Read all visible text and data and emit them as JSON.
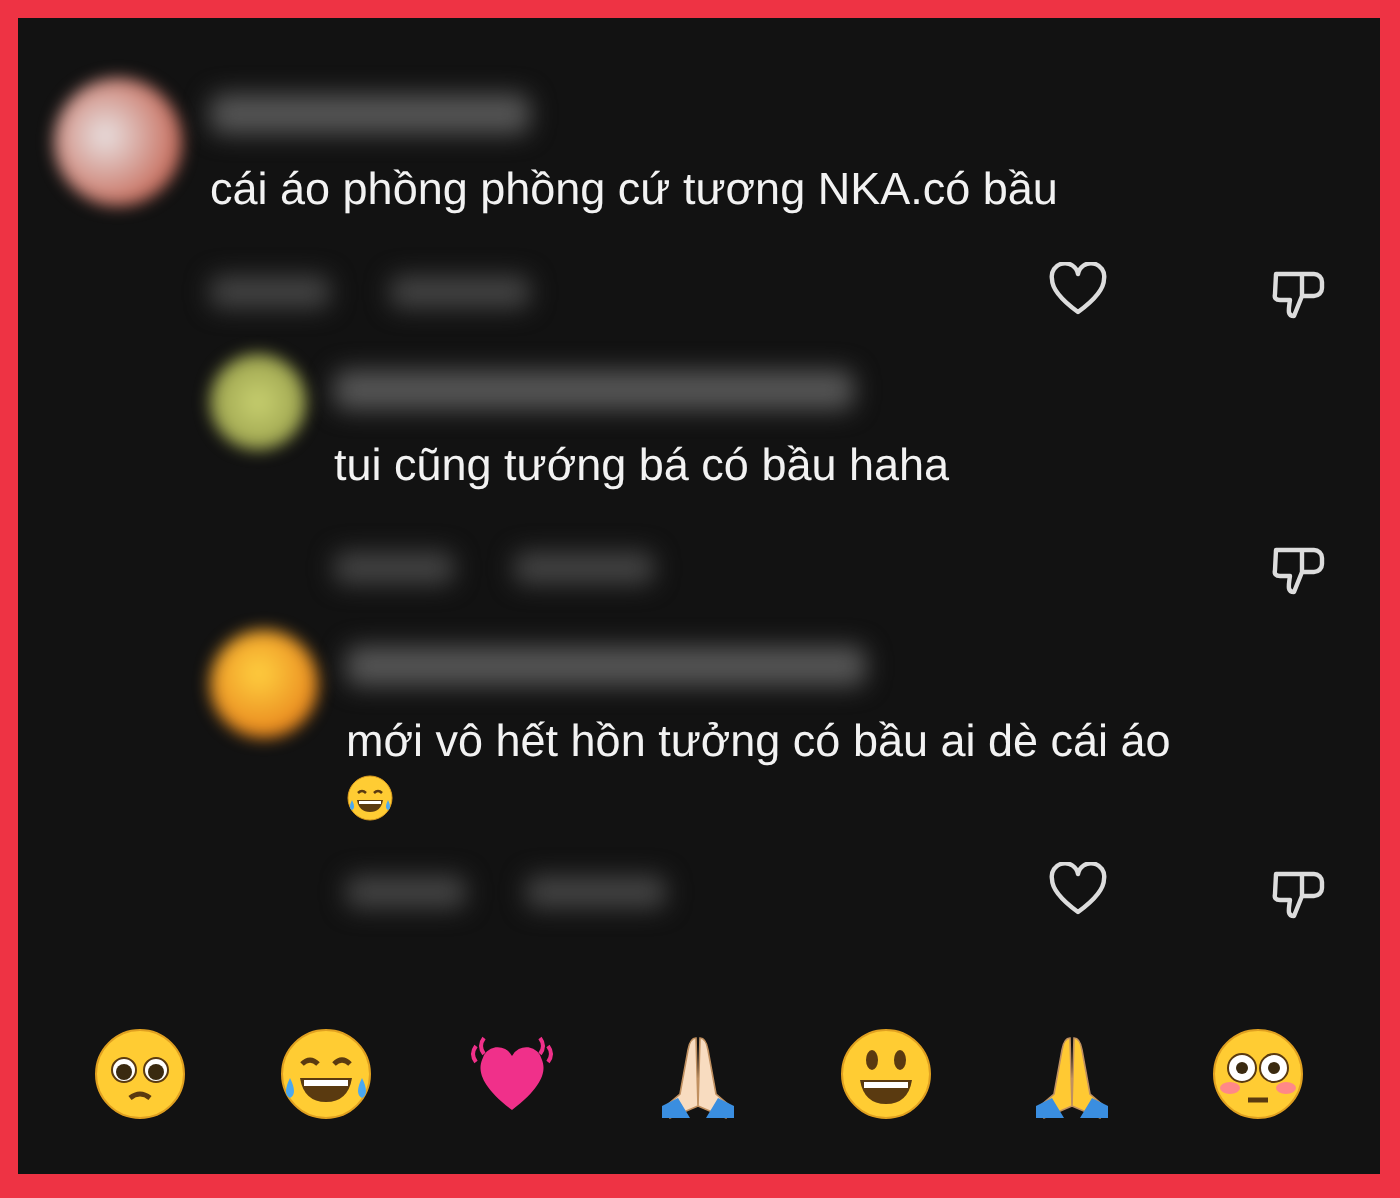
{
  "comments": [
    {
      "kind": "comment",
      "text": "cái áo phồng phồng cứ tương NKA.có bầu",
      "emoji_after": false,
      "heart_visible": true
    },
    {
      "kind": "reply",
      "text": "tui cũng tướng bá có bầu haha",
      "emoji_after": false,
      "heart_visible": false
    },
    {
      "kind": "reply",
      "text": "mới vô hết hồn tưởng có bầu ai dè cái áo",
      "emoji_after": true,
      "heart_visible": true
    }
  ]
}
